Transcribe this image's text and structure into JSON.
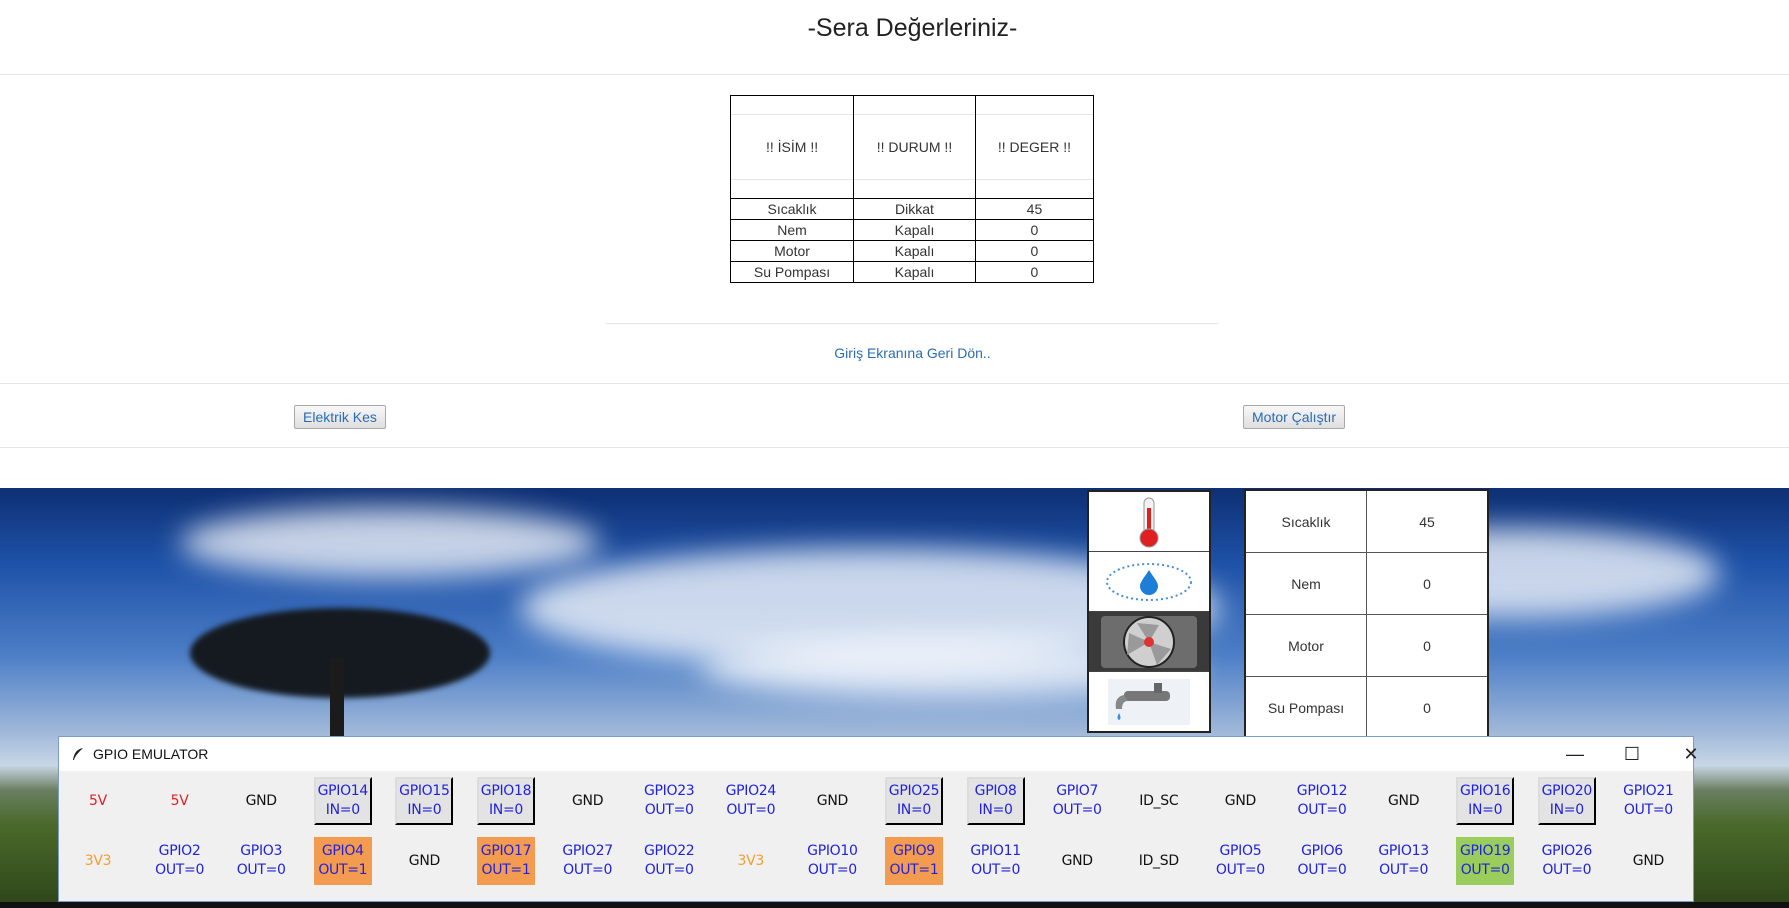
{
  "page": {
    "title": "-Sera Değerleriniz-",
    "back_link": "Giriş Ekranına Geri Dön..",
    "buttons": {
      "cut_power": "Elektrik Kes",
      "run_motor": "Motor Çalıştır"
    }
  },
  "status_table": {
    "headers": [
      "!! İSİM !!",
      "!! DURUM !!",
      "!! DEGER !!"
    ],
    "rows": [
      [
        "Sıcaklık",
        "Dikkat",
        "45"
      ],
      [
        "Nem",
        "Kapalı",
        "0"
      ],
      [
        "Motor",
        "Kapalı",
        "0"
      ],
      [
        "Su Pompası",
        "Kapalı",
        "0"
      ]
    ]
  },
  "side_panel": {
    "icons": [
      "thermometer-icon",
      "water-drop-icon",
      "fan-icon",
      "faucet-icon"
    ],
    "rows": [
      [
        "Sıcaklık",
        "45"
      ],
      [
        "Nem",
        "0"
      ],
      [
        "Motor",
        "0"
      ],
      [
        "Su Pompası",
        "0"
      ]
    ]
  },
  "gpio_window": {
    "title": "GPIO EMULATOR",
    "top_row": [
      {
        "label": "5V",
        "style": "red"
      },
      {
        "label": "5V",
        "style": "red"
      },
      {
        "label": "GND",
        "style": "black"
      },
      {
        "label": "GPIO14\nIN=0",
        "style": "raised"
      },
      {
        "label": "GPIO15\nIN=0",
        "style": "raised"
      },
      {
        "label": "GPIO18\nIN=0",
        "style": "raised"
      },
      {
        "label": "GND",
        "style": "black"
      },
      {
        "label": "GPIO23\nOUT=0",
        "style": "plain"
      },
      {
        "label": "GPIO24\nOUT=0",
        "style": "plain"
      },
      {
        "label": "GND",
        "style": "black"
      },
      {
        "label": "GPIO25\nIN=0",
        "style": "raised"
      },
      {
        "label": "GPIO8\nIN=0",
        "style": "raised"
      },
      {
        "label": "GPIO7\nOUT=0",
        "style": "plain"
      },
      {
        "label": "ID_SC",
        "style": "black"
      },
      {
        "label": "GND",
        "style": "black"
      },
      {
        "label": "GPIO12\nOUT=0",
        "style": "plain"
      },
      {
        "label": "GND",
        "style": "black"
      },
      {
        "label": "GPIO16\nIN=0",
        "style": "raised"
      },
      {
        "label": "GPIO20\nIN=0",
        "style": "raised"
      },
      {
        "label": "GPIO21\nOUT=0",
        "style": "plain"
      }
    ],
    "bottom_row": [
      {
        "label": "3V3",
        "style": "gold"
      },
      {
        "label": "GPIO2\nOUT=0",
        "style": "plain"
      },
      {
        "label": "GPIO3\nOUT=0",
        "style": "plain"
      },
      {
        "label": "GPIO4\nOUT=1",
        "style": "orange"
      },
      {
        "label": "GND",
        "style": "black"
      },
      {
        "label": "GPIO17\nOUT=1",
        "style": "orange"
      },
      {
        "label": "GPIO27\nOUT=0",
        "style": "plain"
      },
      {
        "label": "GPIO22\nOUT=0",
        "style": "plain"
      },
      {
        "label": "3V3",
        "style": "gold"
      },
      {
        "label": "GPIO10\nOUT=0",
        "style": "plain"
      },
      {
        "label": "GPIO9\nOUT=1",
        "style": "orange"
      },
      {
        "label": "GPIO11\nOUT=0",
        "style": "plain"
      },
      {
        "label": "GND",
        "style": "black"
      },
      {
        "label": "ID_SD",
        "style": "black"
      },
      {
        "label": "GPIO5\nOUT=0",
        "style": "plain"
      },
      {
        "label": "GPIO6\nOUT=0",
        "style": "plain"
      },
      {
        "label": "GPIO13\nOUT=0",
        "style": "plain"
      },
      {
        "label": "GPIO19\nOUT=0",
        "style": "green"
      },
      {
        "label": "GPIO26\nOUT=0",
        "style": "plain"
      },
      {
        "label": "GND",
        "style": "black"
      }
    ]
  }
}
